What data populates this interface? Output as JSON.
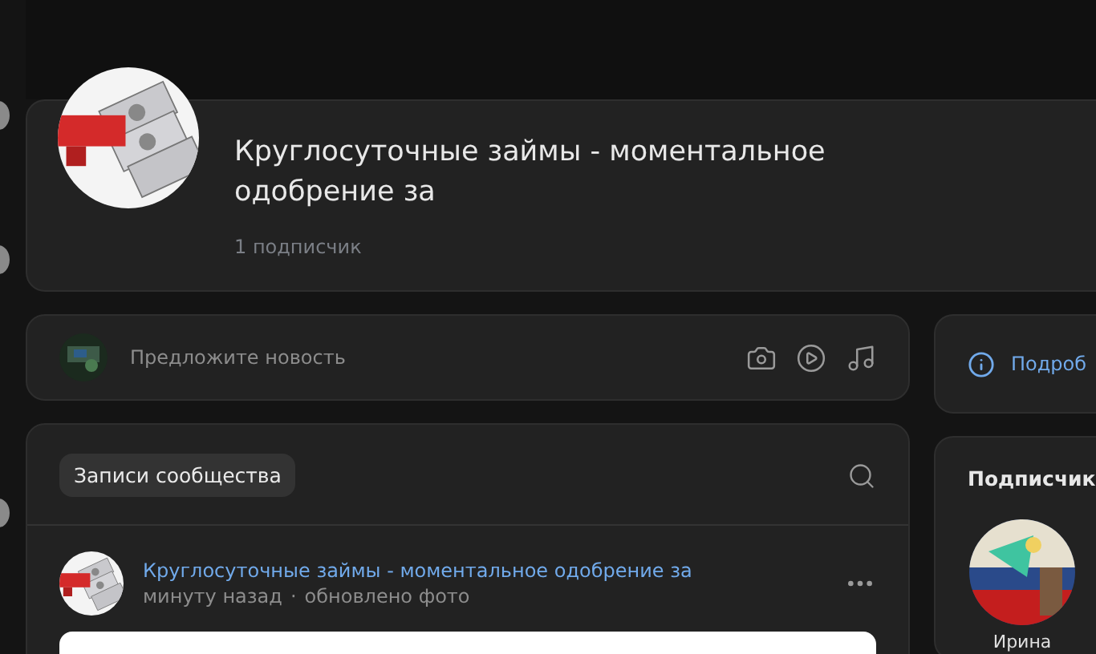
{
  "community": {
    "title": "Круглосуточные займы - моментальное одобрение за",
    "subscribers": "1 подписчик"
  },
  "suggest": {
    "placeholder": "Предложите новость"
  },
  "info": {
    "link": "Подроб"
  },
  "wall": {
    "tabs": [
      {
        "label": "Записи сообщества",
        "selected": true
      }
    ],
    "post": {
      "author": "Круглосуточные займы - моментальное одобрение за",
      "time": "минуту назад",
      "separator": "·",
      "action": "обновлено фото"
    }
  },
  "followers": {
    "title": "Подписчик",
    "people": [
      {
        "name": "Ирина"
      }
    ]
  }
}
